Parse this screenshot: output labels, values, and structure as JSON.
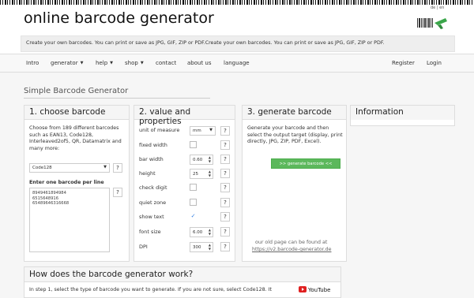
{
  "header": {
    "title": "online barcode generator",
    "language_switch": "de | en",
    "tagline": "Create your own barcodes. You can print or save as JPG, GIF, ZIP or PDF.Create your own barcodes. You can print or save as JPG, GIF, ZIP or PDF."
  },
  "nav": {
    "items": [
      "Intro",
      "generator",
      "help",
      "shop",
      "contact",
      "about us",
      "language"
    ],
    "right": [
      "Register",
      "Login"
    ]
  },
  "page": {
    "heading": "Simple Barcode Generator"
  },
  "step1": {
    "title": "1. choose barcode",
    "description": "Choose from 189 different barcodes such as EAN13, Code128, Interleaved2of5, QR, Datamatrix and many more:",
    "selected_barcode": "Code128",
    "enter_label": "Enter one barcode per line",
    "barcodes": [
      "8949461894984",
      "6515648916",
      "65489646316668"
    ]
  },
  "step2": {
    "title": "2. value and properties",
    "fields": {
      "unit_label": "unit of measure",
      "unit_value": "mm",
      "fixed_width_label": "fixed width",
      "bar_width_label": "bar width",
      "bar_width_value": "0.60",
      "height_label": "height",
      "height_value": "25",
      "check_digit_label": "check digit",
      "quiet_zone_label": "quiet zone",
      "show_text_label": "show text",
      "show_text_checked": "✓",
      "font_size_label": "font size",
      "font_size_value": "6.00",
      "dpi_label": "DPI",
      "dpi_value": "300"
    },
    "help_symbol": "?"
  },
  "step3": {
    "title": "3. generate barcode",
    "description": "Generate your barcode and then select the output target (display, print directly, JPG, ZIP, PDF, Excel).",
    "button": ">> generate barcode <<",
    "old_page_text": "our old page can be found at",
    "old_page_link": "https://v2.barcode-generator.de",
    "button_color": "#5cb85c"
  },
  "info": {
    "title": "Information"
  },
  "how": {
    "title": "How does the barcode generator work?",
    "text": "In step 1, select the type of barcode you want to generate. If you are not sure, select Code128. It",
    "youtube": "YouTube"
  }
}
